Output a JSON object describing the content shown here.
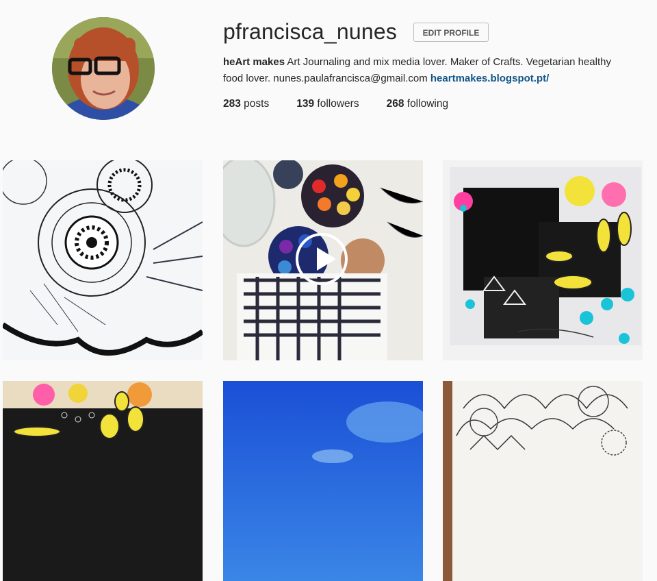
{
  "profile": {
    "username": "pfrancisca_nunes",
    "edit_label": "EDIT PROFILE",
    "bio_name": "heArt makes",
    "bio_text": " Art Journaling and mix media lover. Maker of Crafts. Vegetarian healthy food lover. nunes.paulafrancisca@gmail.com ",
    "link": "heartmakes.blogspot.pt/"
  },
  "stats": [
    {
      "count": "283",
      "label": " posts"
    },
    {
      "count": "139",
      "label": " followers"
    },
    {
      "count": "268",
      "label": " following"
    }
  ],
  "grid": {
    "posts": [
      {
        "kind": "photo",
        "subject": "mandala drawing"
      },
      {
        "kind": "video",
        "subject": "watercolor paints"
      },
      {
        "kind": "photo",
        "subject": "mixed media art journal page"
      },
      {
        "kind": "photo",
        "subject": "art journal detail"
      },
      {
        "kind": "photo",
        "subject": "blue sky"
      },
      {
        "kind": "photo",
        "subject": "zentangle drawing"
      }
    ],
    "play_icon": "play-icon"
  }
}
